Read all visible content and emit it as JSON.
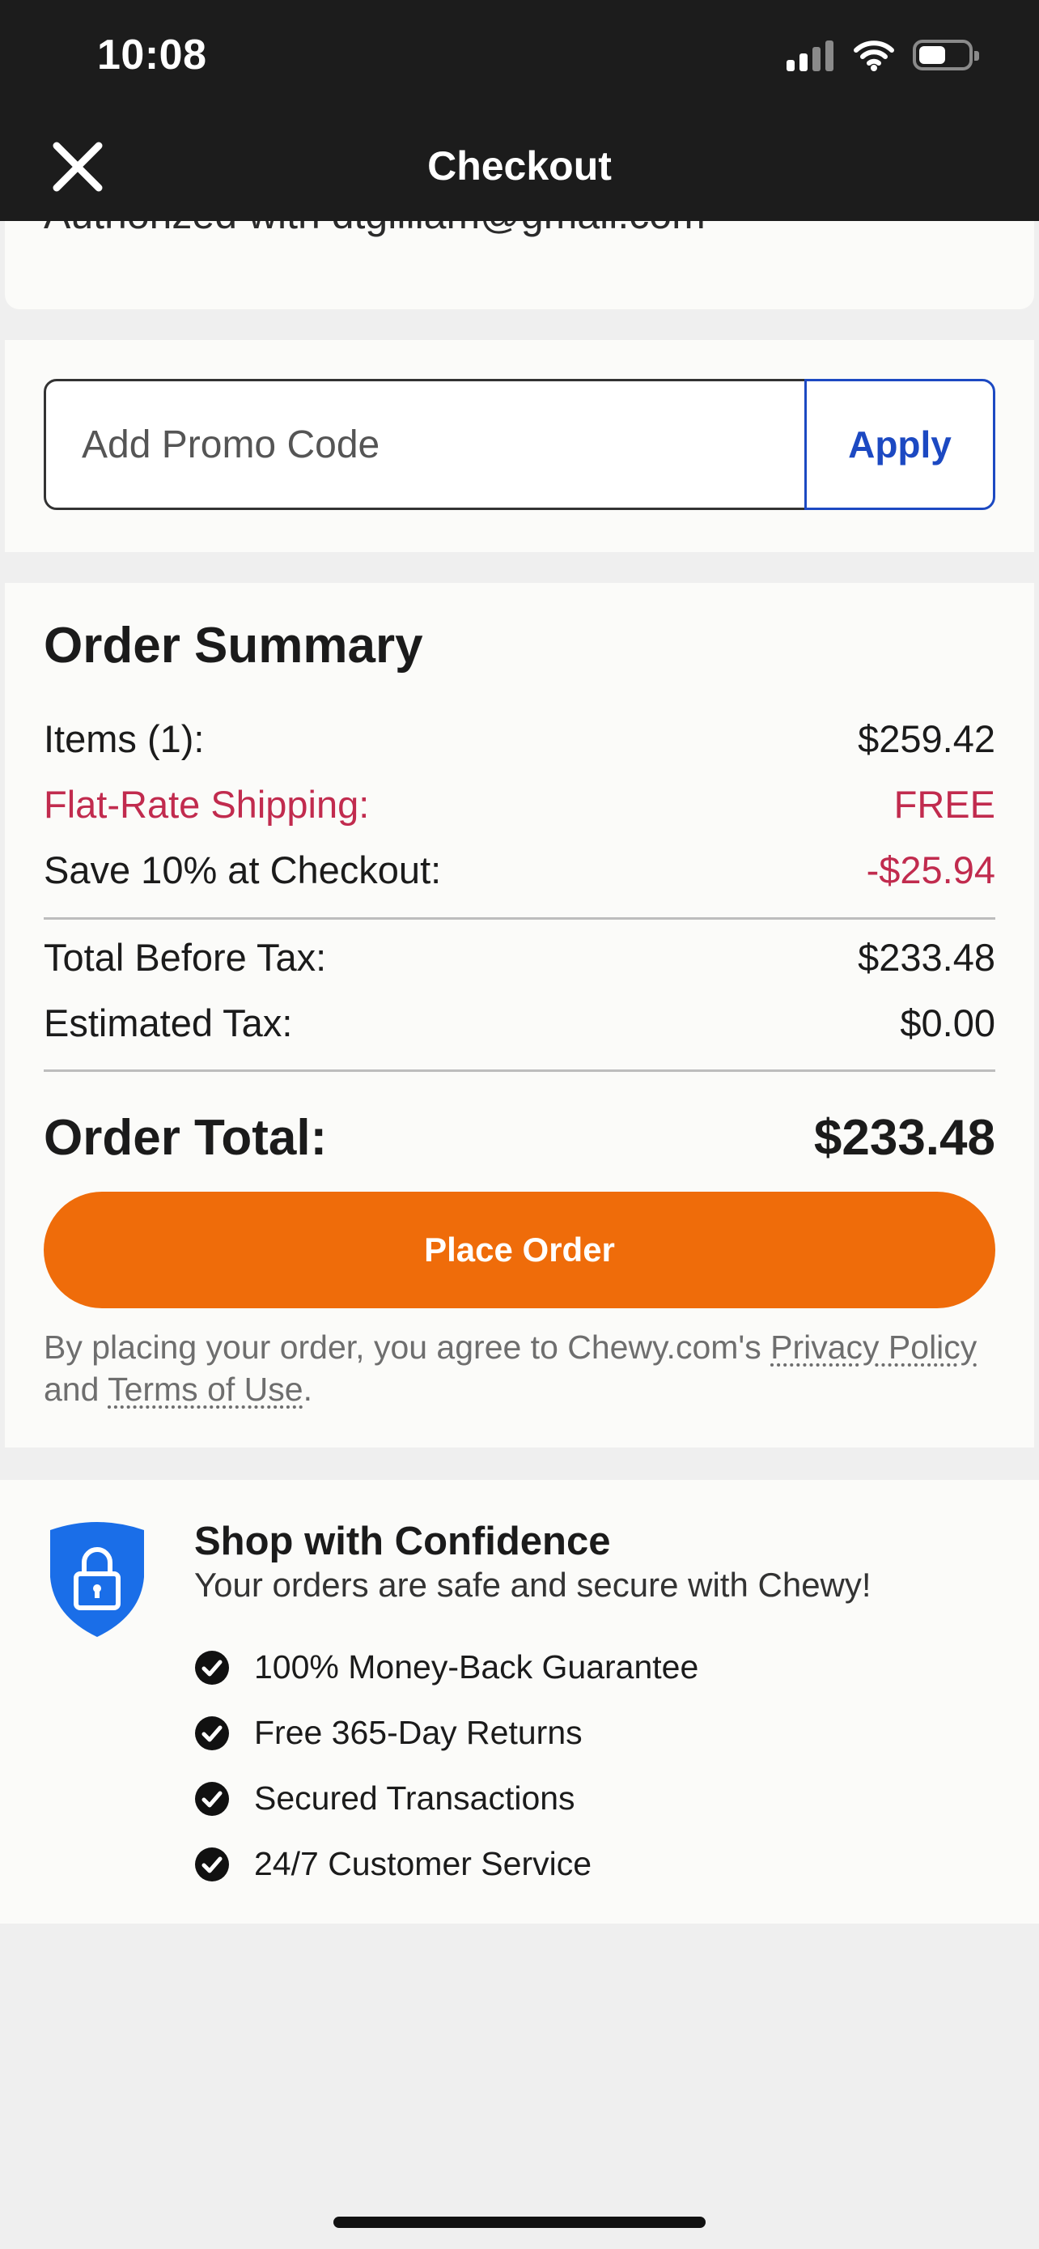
{
  "status_bar": {
    "time": "10:08",
    "battery_level": 0.55
  },
  "nav": {
    "title": "Checkout"
  },
  "auth": {
    "text": "Authorized with dtgilliam@gmail.com"
  },
  "promo": {
    "placeholder": "Add Promo Code",
    "apply_label": "Apply"
  },
  "summary": {
    "title": "Order Summary",
    "rows": [
      {
        "label": "Items (1):",
        "value": "$259.42"
      },
      {
        "label": "Flat-Rate Shipping:",
        "value": "FREE"
      },
      {
        "label": "Save 10% at Checkout:",
        "value": "-$25.94"
      },
      {
        "label": "Total Before Tax:",
        "value": "$233.48"
      },
      {
        "label": "Estimated Tax:",
        "value": "$0.00"
      }
    ],
    "total_label": "Order Total:",
    "total_value": "$233.48",
    "place_order_label": "Place Order",
    "legal_prefix": "By placing your order, you agree to Chewy.com's ",
    "privacy_link": "Privacy Policy",
    "legal_and": " and ",
    "terms_link": "Terms of Use",
    "legal_end": "."
  },
  "confidence": {
    "title": "Shop with Confidence",
    "subtitle": "Your orders are safe and secure with Chewy!",
    "items": [
      "100% Money-Back Guarantee",
      "Free 365-Day Returns",
      "Secured Transactions",
      "24/7 Customer Service"
    ]
  },
  "colors": {
    "accent_red": "#c12b4e",
    "brand_blue": "#1c49c2",
    "place_order_orange": "#ef6c0a",
    "shield_blue": "#1a6ee8"
  }
}
